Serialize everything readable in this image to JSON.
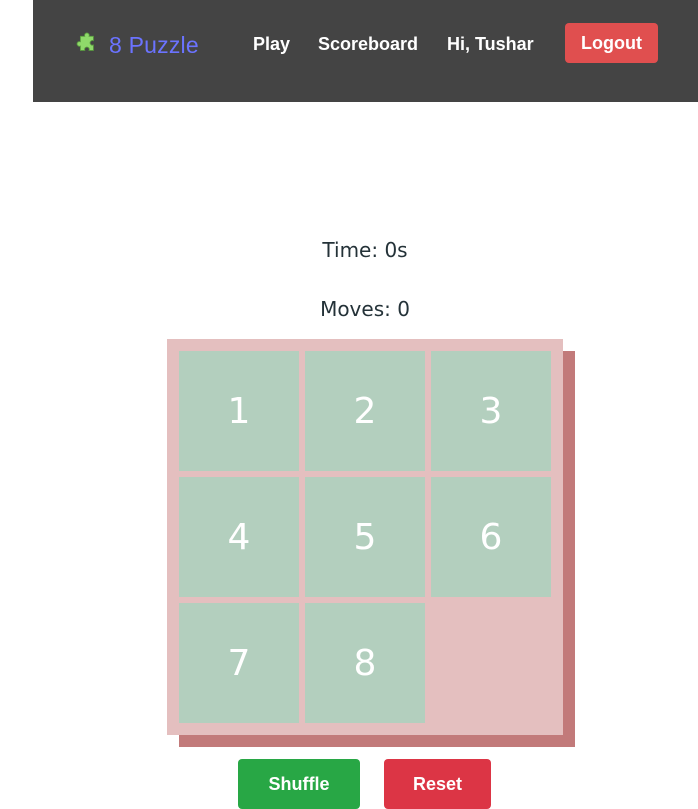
{
  "navbar": {
    "brand_icon": "puzzle-piece-icon",
    "brand_label": "8 Puzzle",
    "links": {
      "play": "Play",
      "scoreboard": "Scoreboard"
    },
    "greeting": "Hi, Tushar",
    "logout_label": "Logout",
    "colors": {
      "background": "#444444",
      "brand": "#6b73ff",
      "logout": "#e04f4f"
    }
  },
  "stats": {
    "time": "Time: 0s",
    "moves": "Moves: 0"
  },
  "board": {
    "tiles": [
      {
        "value": "1",
        "row": 0,
        "col": 0
      },
      {
        "value": "2",
        "row": 0,
        "col": 1
      },
      {
        "value": "3",
        "row": 0,
        "col": 2
      },
      {
        "value": "4",
        "row": 1,
        "col": 0
      },
      {
        "value": "5",
        "row": 1,
        "col": 1
      },
      {
        "value": "6",
        "row": 1,
        "col": 2
      },
      {
        "value": "7",
        "row": 2,
        "col": 0
      },
      {
        "value": "8",
        "row": 2,
        "col": 1
      }
    ],
    "empty": {
      "row": 2,
      "col": 2
    },
    "colors": {
      "tile": "#b3cfbe",
      "board": "#e4bfbf",
      "shadow": "#c27a7a"
    }
  },
  "actions": {
    "shuffle_label": "Shuffle",
    "reset_label": "Reset",
    "colors": {
      "shuffle": "#28a745",
      "reset": "#dc3545"
    }
  }
}
